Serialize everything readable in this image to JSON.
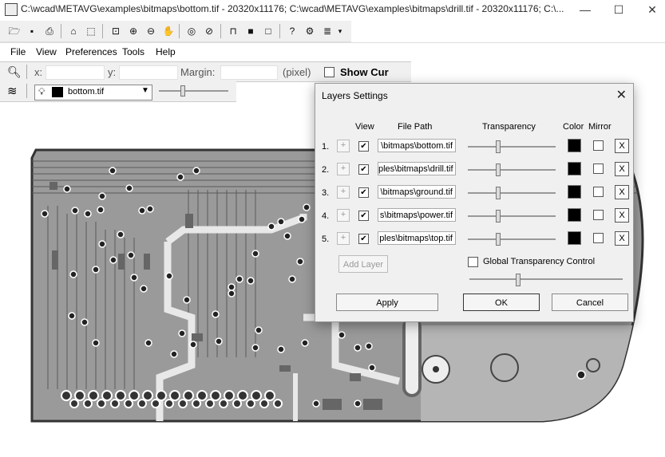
{
  "window": {
    "title": "C:\\wcad\\METAVG\\examples\\bitmaps\\bottom.tif - 20320x11176; C:\\wcad\\METAVG\\examples\\bitmaps\\drill.tif - 20320x11176; C:\\...",
    "minimize": "—",
    "maximize": "☐",
    "close": "✕"
  },
  "toolbar": {
    "icons": [
      "open-icon",
      "save-icon",
      "print-icon",
      "home-icon",
      "select-icon",
      "zoom-window-icon",
      "zoom-in-icon",
      "zoom-out-icon",
      "pan-hand-icon",
      "zoom-fit-icon",
      "zoom-prev-icon",
      "layer-tools-icon",
      "fill-icon",
      "outline-icon",
      "help-icon",
      "settings-icon",
      "list-icon"
    ],
    "glyphs": [
      "🗁",
      "▪",
      "⎙",
      "⌂",
      "⬚",
      "⊡",
      "⊕",
      "⊖",
      "✋",
      "◎",
      "⊘",
      "⊓",
      "■",
      "□",
      "?",
      "⚙",
      "≣"
    ]
  },
  "menu": {
    "items": [
      "File",
      "View",
      "Preferences",
      "Tools",
      "Help"
    ]
  },
  "coords": {
    "x_label": "x:",
    "y_label": "y:",
    "margin_label": "Margin:",
    "unit_label": "(pixel)",
    "show_cursor_label": "Show Cur"
  },
  "layerbar": {
    "selected_layer": "bottom.tif"
  },
  "dialog": {
    "title": "Layers Settings",
    "headers": {
      "view": "View",
      "file_path": "File Path",
      "transparency": "Transparency",
      "color": "Color",
      "mirror": "Mirror"
    },
    "layers": [
      {
        "num": "1.",
        "path": "\\bitmaps\\bottom.tif",
        "view": true,
        "mirror": false,
        "transparency": 0.33,
        "color": "#000000"
      },
      {
        "num": "2.",
        "path": "ples\\bitmaps\\drill.tif",
        "view": true,
        "mirror": false,
        "transparency": 0.33,
        "color": "#000000"
      },
      {
        "num": "3.",
        "path": "\\bitmaps\\ground.tif",
        "view": true,
        "mirror": false,
        "transparency": 0.33,
        "color": "#000000"
      },
      {
        "num": "4.",
        "path": "s\\bitmaps\\power.tif",
        "view": true,
        "mirror": false,
        "transparency": 0.33,
        "color": "#000000"
      },
      {
        "num": "5.",
        "path": "ples\\bitmaps\\top.tif",
        "view": true,
        "mirror": false,
        "transparency": 0.33,
        "color": "#000000"
      }
    ],
    "plus_label": "+",
    "remove_label": "X",
    "add_layer": "Add Layer",
    "global_transparency_label": "Global Transparency Control",
    "global_transparency": 0.3,
    "apply": "Apply",
    "ok": "OK",
    "cancel": "Cancel"
  }
}
